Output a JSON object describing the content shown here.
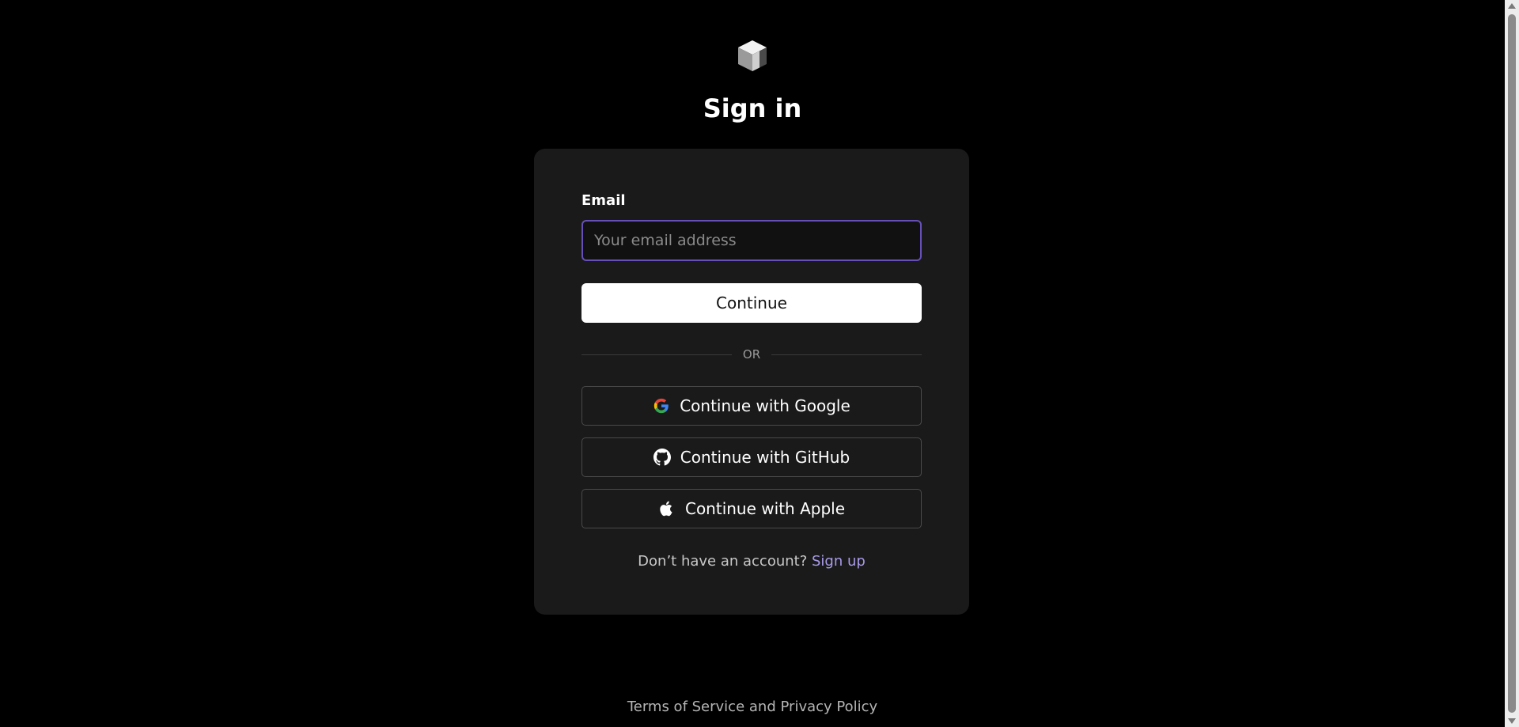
{
  "page": {
    "title": "Sign in",
    "logo_icon": "cube-logo-icon"
  },
  "form": {
    "email_label": "Email",
    "email_placeholder": "Your email address",
    "email_value": "",
    "continue_label": "Continue",
    "divider_label": "OR"
  },
  "oauth": {
    "google_label": "Continue with Google",
    "google_icon": "google-icon",
    "github_label": "Continue with GitHub",
    "github_icon": "github-icon",
    "apple_label": "Continue with Apple",
    "apple_icon": "apple-icon"
  },
  "signup": {
    "prompt": "Don’t have an account?",
    "link_label": "Sign up"
  },
  "footer": {
    "terms_label": "Terms of Service",
    "and_label": "and",
    "privacy_label": "Privacy Policy"
  },
  "colors": {
    "background": "#000000",
    "card": "#1a1a1a",
    "input_focus_border": "#6650b8",
    "link": "#a99ae8"
  }
}
